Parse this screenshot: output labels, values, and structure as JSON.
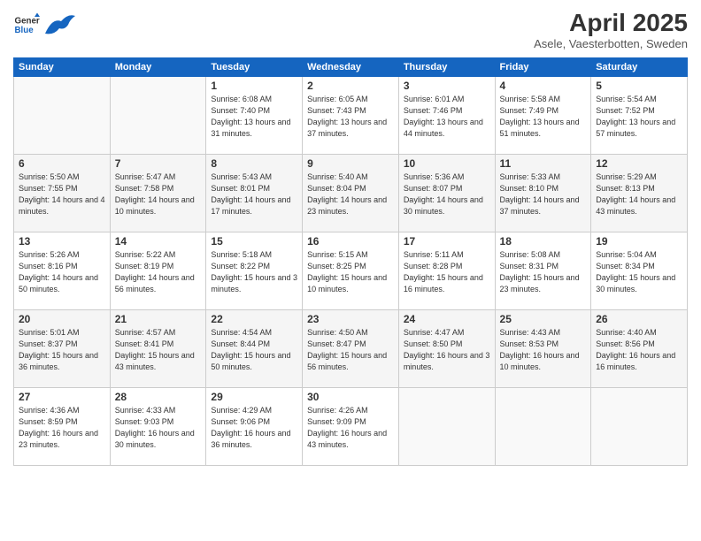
{
  "header": {
    "logo_general": "General",
    "logo_blue": "Blue",
    "month_title": "April 2025",
    "subtitle": "Asele, Vaesterbotten, Sweden"
  },
  "weekdays": [
    "Sunday",
    "Monday",
    "Tuesday",
    "Wednesday",
    "Thursday",
    "Friday",
    "Saturday"
  ],
  "weeks": [
    [
      {
        "day": "",
        "info": ""
      },
      {
        "day": "",
        "info": ""
      },
      {
        "day": "1",
        "info": "Sunrise: 6:08 AM\nSunset: 7:40 PM\nDaylight: 13 hours and 31 minutes."
      },
      {
        "day": "2",
        "info": "Sunrise: 6:05 AM\nSunset: 7:43 PM\nDaylight: 13 hours and 37 minutes."
      },
      {
        "day": "3",
        "info": "Sunrise: 6:01 AM\nSunset: 7:46 PM\nDaylight: 13 hours and 44 minutes."
      },
      {
        "day": "4",
        "info": "Sunrise: 5:58 AM\nSunset: 7:49 PM\nDaylight: 13 hours and 51 minutes."
      },
      {
        "day": "5",
        "info": "Sunrise: 5:54 AM\nSunset: 7:52 PM\nDaylight: 13 hours and 57 minutes."
      }
    ],
    [
      {
        "day": "6",
        "info": "Sunrise: 5:50 AM\nSunset: 7:55 PM\nDaylight: 14 hours and 4 minutes."
      },
      {
        "day": "7",
        "info": "Sunrise: 5:47 AM\nSunset: 7:58 PM\nDaylight: 14 hours and 10 minutes."
      },
      {
        "day": "8",
        "info": "Sunrise: 5:43 AM\nSunset: 8:01 PM\nDaylight: 14 hours and 17 minutes."
      },
      {
        "day": "9",
        "info": "Sunrise: 5:40 AM\nSunset: 8:04 PM\nDaylight: 14 hours and 23 minutes."
      },
      {
        "day": "10",
        "info": "Sunrise: 5:36 AM\nSunset: 8:07 PM\nDaylight: 14 hours and 30 minutes."
      },
      {
        "day": "11",
        "info": "Sunrise: 5:33 AM\nSunset: 8:10 PM\nDaylight: 14 hours and 37 minutes."
      },
      {
        "day": "12",
        "info": "Sunrise: 5:29 AM\nSunset: 8:13 PM\nDaylight: 14 hours and 43 minutes."
      }
    ],
    [
      {
        "day": "13",
        "info": "Sunrise: 5:26 AM\nSunset: 8:16 PM\nDaylight: 14 hours and 50 minutes."
      },
      {
        "day": "14",
        "info": "Sunrise: 5:22 AM\nSunset: 8:19 PM\nDaylight: 14 hours and 56 minutes."
      },
      {
        "day": "15",
        "info": "Sunrise: 5:18 AM\nSunset: 8:22 PM\nDaylight: 15 hours and 3 minutes."
      },
      {
        "day": "16",
        "info": "Sunrise: 5:15 AM\nSunset: 8:25 PM\nDaylight: 15 hours and 10 minutes."
      },
      {
        "day": "17",
        "info": "Sunrise: 5:11 AM\nSunset: 8:28 PM\nDaylight: 15 hours and 16 minutes."
      },
      {
        "day": "18",
        "info": "Sunrise: 5:08 AM\nSunset: 8:31 PM\nDaylight: 15 hours and 23 minutes."
      },
      {
        "day": "19",
        "info": "Sunrise: 5:04 AM\nSunset: 8:34 PM\nDaylight: 15 hours and 30 minutes."
      }
    ],
    [
      {
        "day": "20",
        "info": "Sunrise: 5:01 AM\nSunset: 8:37 PM\nDaylight: 15 hours and 36 minutes."
      },
      {
        "day": "21",
        "info": "Sunrise: 4:57 AM\nSunset: 8:41 PM\nDaylight: 15 hours and 43 minutes."
      },
      {
        "day": "22",
        "info": "Sunrise: 4:54 AM\nSunset: 8:44 PM\nDaylight: 15 hours and 50 minutes."
      },
      {
        "day": "23",
        "info": "Sunrise: 4:50 AM\nSunset: 8:47 PM\nDaylight: 15 hours and 56 minutes."
      },
      {
        "day": "24",
        "info": "Sunrise: 4:47 AM\nSunset: 8:50 PM\nDaylight: 16 hours and 3 minutes."
      },
      {
        "day": "25",
        "info": "Sunrise: 4:43 AM\nSunset: 8:53 PM\nDaylight: 16 hours and 10 minutes."
      },
      {
        "day": "26",
        "info": "Sunrise: 4:40 AM\nSunset: 8:56 PM\nDaylight: 16 hours and 16 minutes."
      }
    ],
    [
      {
        "day": "27",
        "info": "Sunrise: 4:36 AM\nSunset: 8:59 PM\nDaylight: 16 hours and 23 minutes."
      },
      {
        "day": "28",
        "info": "Sunrise: 4:33 AM\nSunset: 9:03 PM\nDaylight: 16 hours and 30 minutes."
      },
      {
        "day": "29",
        "info": "Sunrise: 4:29 AM\nSunset: 9:06 PM\nDaylight: 16 hours and 36 minutes."
      },
      {
        "day": "30",
        "info": "Sunrise: 4:26 AM\nSunset: 9:09 PM\nDaylight: 16 hours and 43 minutes."
      },
      {
        "day": "",
        "info": ""
      },
      {
        "day": "",
        "info": ""
      },
      {
        "day": "",
        "info": ""
      }
    ]
  ]
}
